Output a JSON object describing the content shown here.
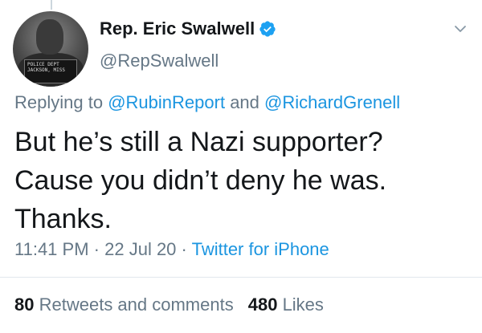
{
  "author": {
    "display_name": "Rep. Eric Swalwell",
    "handle": "@RepSwalwell",
    "avatar_placard": "POLICE DEPT\nJACKSON, MISS",
    "verified_icon": "verified-badge-icon",
    "verified_color": "#1da1f2"
  },
  "reply": {
    "prefix": "Replying to",
    "mention_1": "@RubinReport",
    "joiner": "and",
    "mention_2": "@RichardGrenell"
  },
  "tweet": {
    "lines": [
      "But he’s still a Nazi supporter?",
      "Cause you didn’t deny he was.",
      "Thanks."
    ]
  },
  "meta": {
    "time": "11:41 PM",
    "sep": "·",
    "date": "22 Jul 20",
    "source": "Twitter for iPhone"
  },
  "stats": {
    "retweets_count": "80",
    "retweets_label": "Retweets and comments",
    "likes_count": "480",
    "likes_label": "Likes"
  },
  "colors": {
    "link": "#1b95e0",
    "secondary_text": "#657786",
    "primary_text": "#14171a",
    "divider": "#e1e8ed"
  },
  "icons": {
    "menu": "chevron-down-icon"
  }
}
